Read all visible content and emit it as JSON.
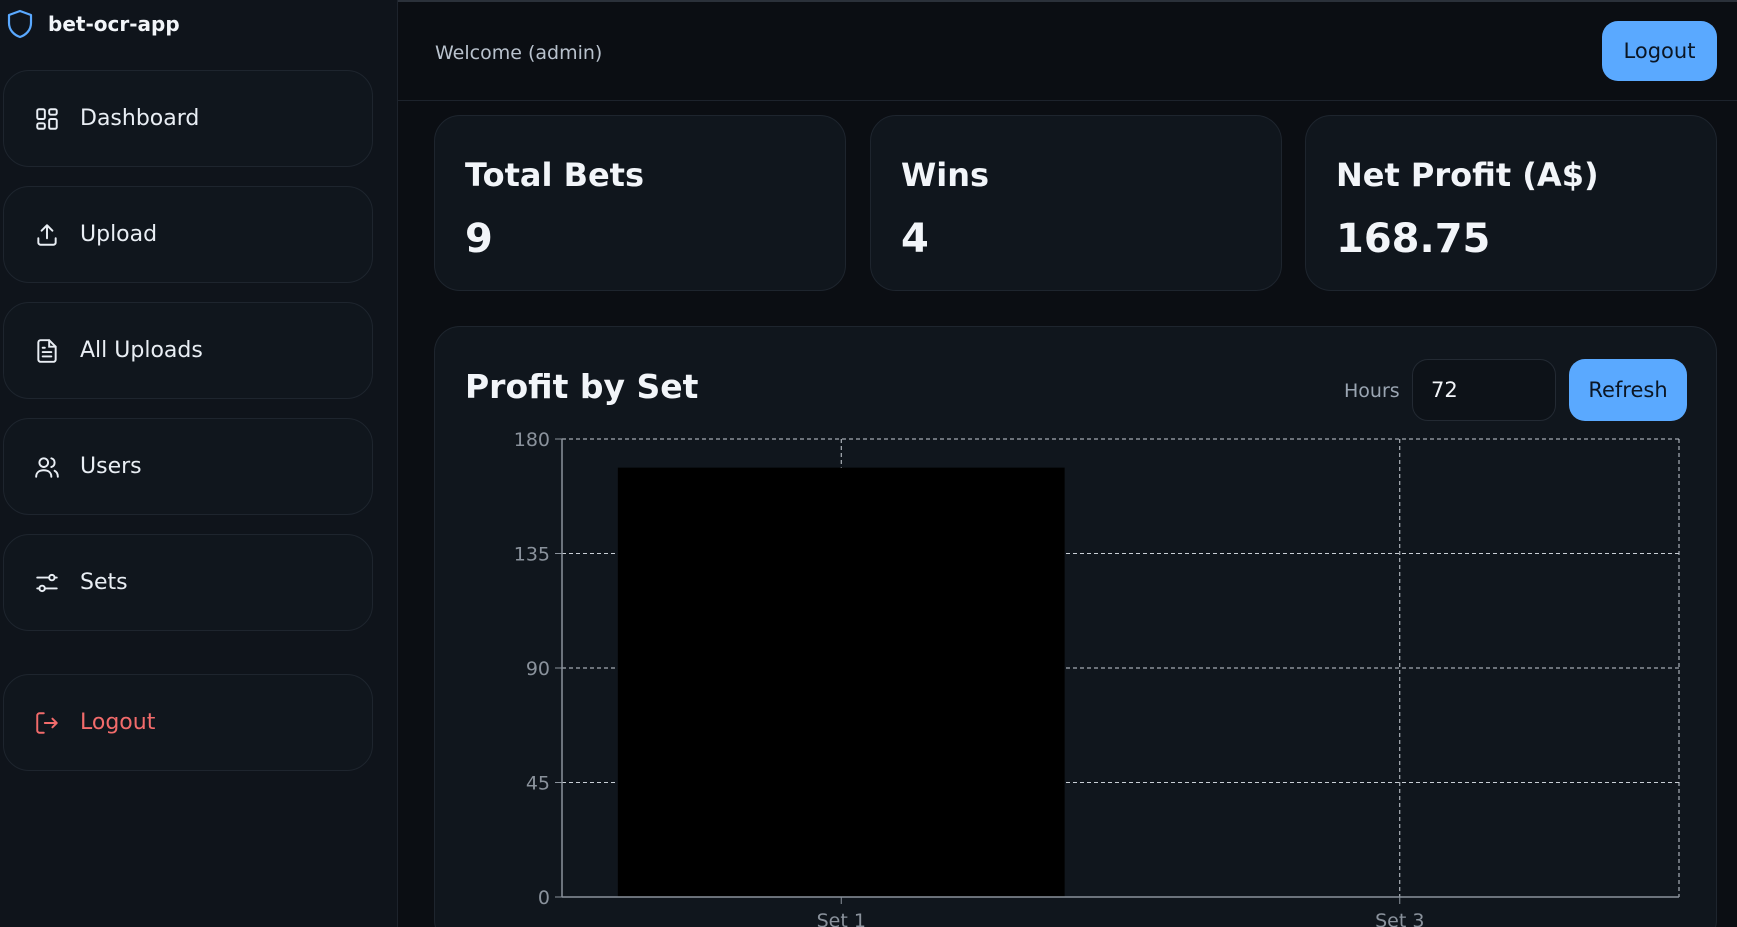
{
  "app": {
    "name": "bet-ocr-app"
  },
  "sidebar": {
    "items": [
      {
        "label": "Dashboard",
        "icon": "dashboard-icon"
      },
      {
        "label": "Upload",
        "icon": "upload-icon"
      },
      {
        "label": "All Uploads",
        "icon": "document-icon"
      },
      {
        "label": "Users",
        "icon": "users-icon"
      },
      {
        "label": "Sets",
        "icon": "sliders-icon"
      }
    ],
    "logout_label": "Logout"
  },
  "header": {
    "welcome": "Welcome (admin)",
    "logout_label": "Logout"
  },
  "stats": [
    {
      "label": "Total Bets",
      "value": "9"
    },
    {
      "label": "Wins",
      "value": "4"
    },
    {
      "label": "Net Profit (A$)",
      "value": "168.75"
    }
  ],
  "chart_panel": {
    "title": "Profit by Set",
    "hours_label": "Hours",
    "hours_value": "72",
    "refresh_label": "Refresh"
  },
  "colors": {
    "accent": "#5aa9ff",
    "danger": "#f26b6b",
    "bar": "#000000"
  },
  "chart_data": {
    "type": "bar",
    "categories": [
      "Set 1",
      "Set 3"
    ],
    "values": [
      168.75,
      0
    ],
    "yticks": [
      0,
      45,
      90,
      135,
      180
    ],
    "ylim": [
      0,
      180
    ],
    "grid": true,
    "title": "Profit by Set",
    "xlabel": "",
    "ylabel": ""
  }
}
